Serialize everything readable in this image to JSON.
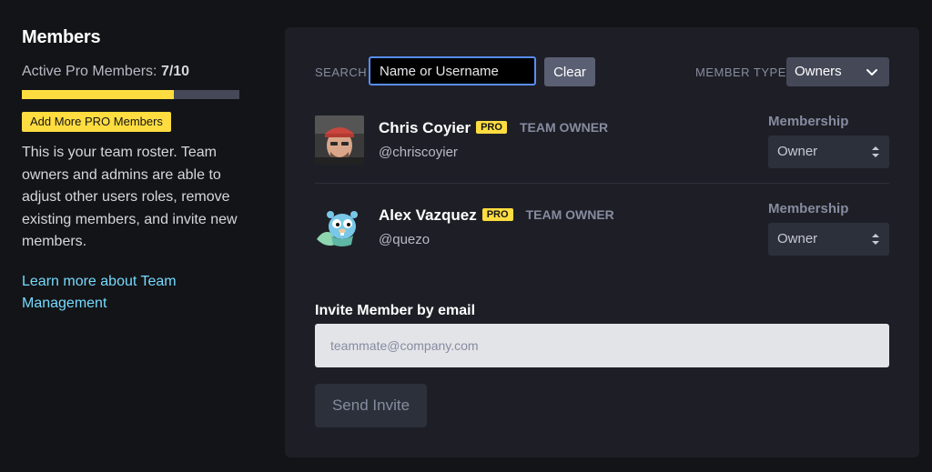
{
  "sidebar": {
    "title": "Members",
    "active_label": "Active Pro Members: ",
    "active_count": "7/10",
    "progress_fraction": 0.7,
    "add_pro_label": "Add More PRO Members",
    "description": "This is your team roster. Team owners and admins are able to adjust other users roles, remove existing members, and invite new members.",
    "learn_more": "Learn more about Team Management"
  },
  "toolbar": {
    "search_label": "SEARCH",
    "search_placeholder": "Name or Username",
    "clear_label": "Clear",
    "member_type_label": "MEMBER TYPE",
    "member_type_value": "Owners"
  },
  "members": [
    {
      "name": "Chris Coyier",
      "badge": "PRO",
      "role": "TEAM OWNER",
      "handle": "@chriscoyier",
      "membership_label": "Membership",
      "membership_value": "Owner"
    },
    {
      "name": "Alex Vazquez",
      "badge": "PRO",
      "role": "TEAM OWNER",
      "handle": "@quezo",
      "membership_label": "Membership",
      "membership_value": "Owner"
    }
  ],
  "invite": {
    "title": "Invite Member by email",
    "placeholder": "teammate@company.com",
    "send_label": "Send Invite"
  },
  "colors": {
    "accent_yellow": "#ffdd40",
    "link_blue": "#76daff",
    "focus_blue": "#5a8df5"
  }
}
